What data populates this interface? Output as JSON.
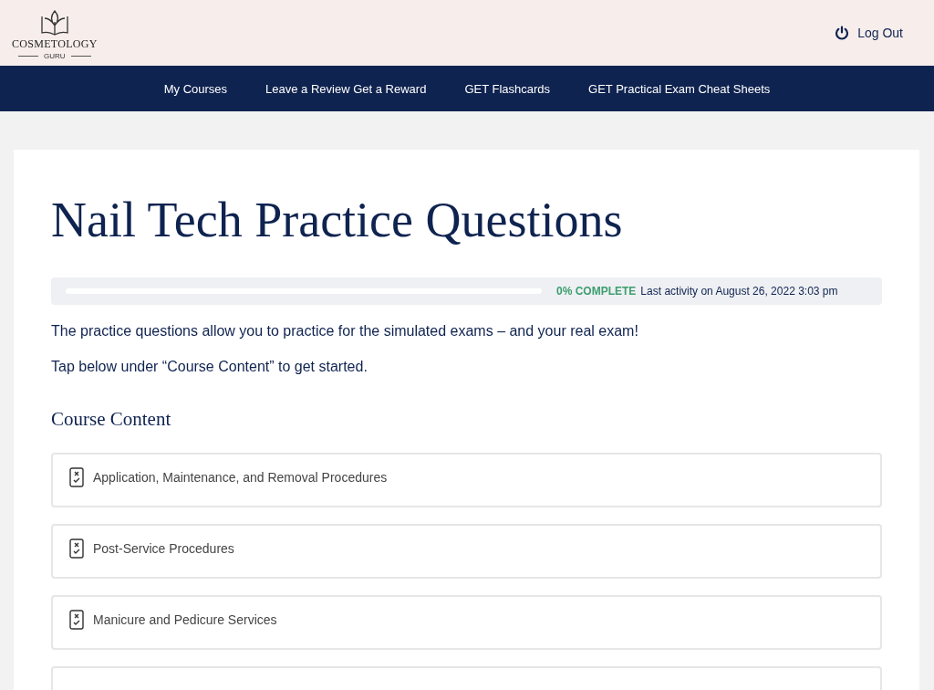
{
  "logo": {
    "name": "COSMETOLOGY",
    "tagline": "GURU"
  },
  "logout": {
    "label": "Log Out"
  },
  "nav": [
    {
      "label": "My Courses"
    },
    {
      "label": "Leave a Review Get a Reward"
    },
    {
      "label": "GET Flashcards"
    },
    {
      "label": "GET Practical Exam Cheat Sheets"
    }
  ],
  "title": "Nail Tech Practice Questions",
  "progress": {
    "level": 0,
    "percent": "0% COMPLETE",
    "activity": "Last activity on August 26, 2022 3:03 pm"
  },
  "intro": [
    "The practice questions allow you to practice for the simulated exams – and your real exam!",
    "Tap below under “Course Content” to get started."
  ],
  "course_content": {
    "heading": "Course Content",
    "lessons": [
      {
        "title": "Application, Maintenance, and Removal Procedures"
      },
      {
        "title": "Post-Service Procedures"
      },
      {
        "title": "Manicure and Pedicure Services"
      }
    ]
  }
}
